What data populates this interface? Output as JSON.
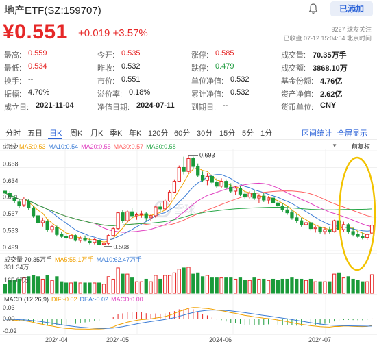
{
  "header": {
    "title": "地产ETF(SZ:159707)",
    "add_button": "已添加"
  },
  "quote": {
    "price": "¥0.551",
    "change": "+0.019 +3.57%",
    "followers": "9227 球友关注",
    "status": "已收盘 07-12 15:04:54 北京时间"
  },
  "stats": [
    [
      {
        "k": "最高:",
        "v": "0.559",
        "c": "red"
      },
      {
        "k": "今开:",
        "v": "0.535",
        "c": "red"
      },
      {
        "k": "涨停:",
        "v": "0.585",
        "c": "red"
      },
      {
        "k": "成交量:",
        "v": "70.35万手",
        "c": "bold"
      }
    ],
    [
      {
        "k": "最低:",
        "v": "0.534",
        "c": "red"
      },
      {
        "k": "昨收:",
        "v": "0.532",
        "c": ""
      },
      {
        "k": "跌停:",
        "v": "0.479",
        "c": "green"
      },
      {
        "k": "成交额:",
        "v": "3868.10万",
        "c": "bold"
      }
    ],
    [
      {
        "k": "换手:",
        "v": "--",
        "c": ""
      },
      {
        "k": "市价:",
        "v": "0.551",
        "c": ""
      },
      {
        "k": "单位净值:",
        "v": "0.532",
        "c": ""
      },
      {
        "k": "基金份额:",
        "v": "4.76亿",
        "c": "bold"
      }
    ],
    [
      {
        "k": "振幅:",
        "v": "4.70%",
        "c": ""
      },
      {
        "k": "溢价率:",
        "v": "0.18%",
        "c": ""
      },
      {
        "k": "累计净值:",
        "v": "0.532",
        "c": ""
      },
      {
        "k": "资产净值:",
        "v": "2.62亿",
        "c": "bold"
      }
    ],
    [
      {
        "k": "成立日:",
        "v": "2021-11-04",
        "c": "bold"
      },
      {
        "k": "净值日期:",
        "v": "2024-07-11",
        "c": "bold"
      },
      {
        "k": "到期日:",
        "v": "--",
        "c": ""
      },
      {
        "k": "货币单位:",
        "v": "CNY",
        "c": "bold"
      }
    ]
  ],
  "tabs": [
    "分时",
    "五日",
    "日K",
    "周K",
    "月K",
    "季K",
    "年K",
    "120分",
    "60分",
    "30分",
    "15分",
    "5分",
    "1分"
  ],
  "active_tab": "日K",
  "tab_links": [
    "区间统计",
    "全屏显示"
  ],
  "ma_legend": [
    {
      "label": "均线",
      "color": "#555555"
    },
    {
      "label": "MA5:0.53",
      "color": "#f0a000"
    },
    {
      "label": "MA10:0.54",
      "color": "#3a7bd5"
    },
    {
      "label": "MA20:0.55",
      "color": "#e040c0"
    },
    {
      "label": "MA30:0.57",
      "color": "#ff6060"
    },
    {
      "label": "MA60:0.58",
      "color": "#2aa84a"
    }
  ],
  "adjust_label": "前复权",
  "price_axis": [
    "0.702",
    "0.668",
    "0.634",
    "0.601",
    "0.567",
    "0.533",
    "0.499"
  ],
  "annotations": {
    "high": "0.693",
    "low": "0.508"
  },
  "volume_legend": [
    {
      "label": "成交量 70.35万手",
      "color": "#333333"
    },
    {
      "label": "MA5:55.1万手",
      "color": "#f0a000"
    },
    {
      "label": "MA10:62.47万手",
      "color": "#3a7bd5"
    }
  ],
  "volume_axis": [
    "331.34万",
    "165.67万"
  ],
  "macd_legend": [
    {
      "label": "MACD (12,26,9)",
      "color": "#333333"
    },
    {
      "label": "DIF:-0.02",
      "color": "#f0a000"
    },
    {
      "label": "DEA:-0.02",
      "color": "#3a7bd5"
    },
    {
      "label": "MACD:0.00",
      "color": "#e040c0"
    }
  ],
  "macd_axis": [
    "0.03",
    "0.00",
    "-0.02"
  ],
  "date_axis": [
    "2024-04",
    "2024-05",
    "2024-06",
    "2024-07"
  ],
  "chart_data": {
    "type": "candlestick",
    "symbol": "SZ:159707",
    "ylim": [
      0.499,
      0.702
    ],
    "candles": [
      [
        0.62,
        0.622,
        0.612,
        0.616
      ],
      [
        0.616,
        0.62,
        0.604,
        0.608
      ],
      [
        0.606,
        0.612,
        0.596,
        0.6
      ],
      [
        0.598,
        0.604,
        0.586,
        0.59
      ],
      [
        0.592,
        0.608,
        0.588,
        0.604
      ],
      [
        0.6,
        0.604,
        0.582,
        0.586
      ],
      [
        0.586,
        0.59,
        0.566,
        0.57
      ],
      [
        0.57,
        0.574,
        0.552,
        0.556
      ],
      [
        0.556,
        0.566,
        0.548,
        0.56
      ],
      [
        0.558,
        0.562,
        0.538,
        0.542
      ],
      [
        0.542,
        0.552,
        0.536,
        0.548
      ],
      [
        0.546,
        0.55,
        0.528,
        0.532
      ],
      [
        0.532,
        0.538,
        0.524,
        0.528
      ],
      [
        0.528,
        0.534,
        0.522,
        0.526
      ],
      [
        0.524,
        0.532,
        0.52,
        0.53
      ],
      [
        0.53,
        0.532,
        0.518,
        0.52
      ],
      [
        0.52,
        0.528,
        0.516,
        0.524
      ],
      [
        0.524,
        0.53,
        0.518,
        0.52
      ],
      [
        0.518,
        0.524,
        0.512,
        0.516
      ],
      [
        0.516,
        0.524,
        0.512,
        0.522
      ],
      [
        0.52,
        0.522,
        0.51,
        0.512
      ],
      [
        0.512,
        0.518,
        0.508,
        0.514
      ],
      [
        0.514,
        0.532,
        0.51,
        0.53
      ],
      [
        0.53,
        0.546,
        0.528,
        0.544
      ],
      [
        0.544,
        0.578,
        0.542,
        0.576
      ],
      [
        0.576,
        0.582,
        0.556,
        0.56
      ],
      [
        0.56,
        0.582,
        0.556,
        0.578
      ],
      [
        0.578,
        0.586,
        0.566,
        0.57
      ],
      [
        0.57,
        0.576,
        0.562,
        0.572
      ],
      [
        0.572,
        0.58,
        0.566,
        0.574
      ],
      [
        0.574,
        0.578,
        0.56,
        0.566
      ],
      [
        0.566,
        0.574,
        0.56,
        0.57
      ],
      [
        0.57,
        0.59,
        0.566,
        0.588
      ],
      [
        0.588,
        0.596,
        0.578,
        0.584
      ],
      [
        0.584,
        0.604,
        0.58,
        0.6
      ],
      [
        0.6,
        0.622,
        0.598,
        0.618
      ],
      [
        0.618,
        0.644,
        0.616,
        0.64
      ],
      [
        0.64,
        0.672,
        0.638,
        0.668
      ],
      [
        0.668,
        0.69,
        0.654,
        0.66
      ],
      [
        0.66,
        0.693,
        0.656,
        0.686
      ],
      [
        0.686,
        0.69,
        0.664,
        0.67
      ],
      [
        0.67,
        0.676,
        0.648,
        0.652
      ],
      [
        0.652,
        0.66,
        0.638,
        0.642
      ],
      [
        0.642,
        0.656,
        0.632,
        0.65
      ],
      [
        0.65,
        0.654,
        0.634,
        0.638
      ],
      [
        0.638,
        0.646,
        0.626,
        0.63
      ],
      [
        0.63,
        0.646,
        0.626,
        0.64
      ],
      [
        0.64,
        0.644,
        0.624,
        0.628
      ],
      [
        0.628,
        0.636,
        0.616,
        0.62
      ],
      [
        0.62,
        0.63,
        0.612,
        0.626
      ],
      [
        0.626,
        0.63,
        0.61,
        0.614
      ],
      [
        0.614,
        0.62,
        0.604,
        0.608
      ],
      [
        0.608,
        0.62,
        0.604,
        0.616
      ],
      [
        0.616,
        0.622,
        0.602,
        0.606
      ],
      [
        0.606,
        0.614,
        0.596,
        0.61
      ],
      [
        0.61,
        0.616,
        0.598,
        0.602
      ],
      [
        0.602,
        0.61,
        0.594,
        0.606
      ],
      [
        0.606,
        0.61,
        0.592,
        0.596
      ],
      [
        0.596,
        0.602,
        0.586,
        0.59
      ],
      [
        0.59,
        0.596,
        0.578,
        0.582
      ],
      [
        0.582,
        0.59,
        0.572,
        0.576
      ],
      [
        0.576,
        0.582,
        0.562,
        0.566
      ],
      [
        0.566,
        0.574,
        0.556,
        0.56
      ],
      [
        0.56,
        0.566,
        0.548,
        0.552
      ],
      [
        0.552,
        0.56,
        0.544,
        0.556
      ],
      [
        0.556,
        0.558,
        0.54,
        0.544
      ],
      [
        0.544,
        0.55,
        0.536,
        0.546
      ],
      [
        0.546,
        0.548,
        0.534,
        0.538
      ],
      [
        0.538,
        0.546,
        0.532,
        0.542
      ],
      [
        0.542,
        0.548,
        0.534,
        0.538
      ],
      [
        0.538,
        0.562,
        0.536,
        0.56
      ],
      [
        0.56,
        0.566,
        0.538,
        0.542
      ],
      [
        0.542,
        0.558,
        0.538,
        0.552
      ],
      [
        0.552,
        0.556,
        0.534,
        0.538
      ],
      [
        0.538,
        0.546,
        0.528,
        0.532
      ],
      [
        0.532,
        0.54,
        0.524,
        0.528
      ],
      [
        0.528,
        0.536,
        0.522,
        0.526
      ],
      [
        0.526,
        0.534,
        0.52,
        0.532
      ],
      [
        0.535,
        0.559,
        0.534,
        0.551
      ]
    ]
  }
}
